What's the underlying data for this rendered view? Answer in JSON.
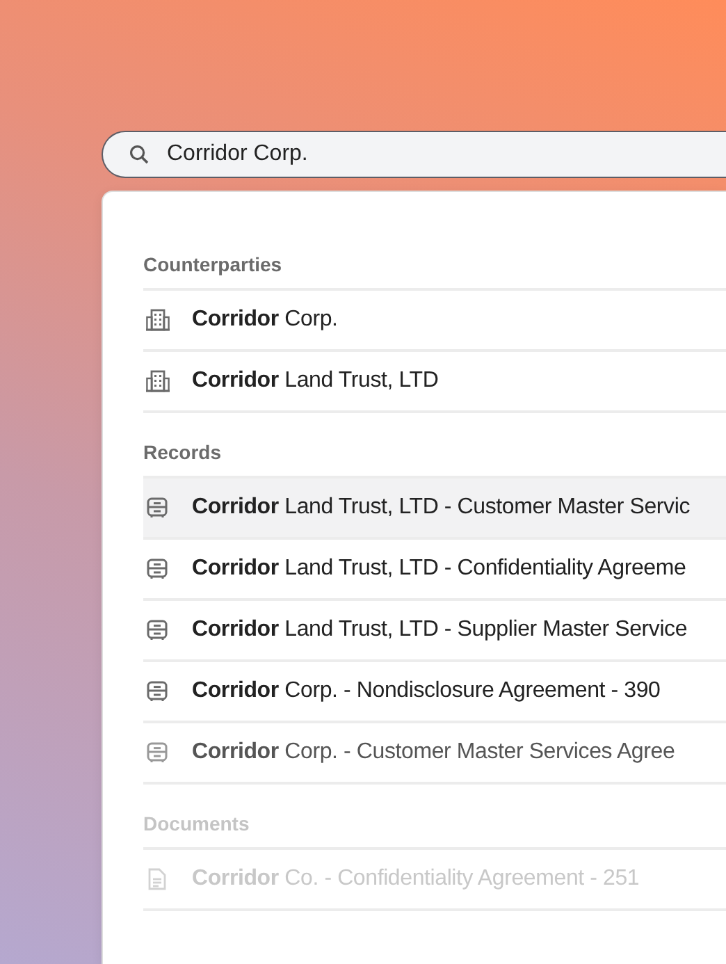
{
  "search": {
    "value": "Corridor Corp."
  },
  "sections": [
    {
      "heading": "Counterparties",
      "kind": "counterparty",
      "dimmed": false,
      "items": [
        {
          "label": "**Corridor** Corp.",
          "selected": false,
          "kind": "normal"
        },
        {
          "label": "**Corridor** Land Trust, LTD",
          "selected": false,
          "kind": "normal"
        }
      ]
    },
    {
      "heading": "Records",
      "kind": "record",
      "dimmed": false,
      "items": [
        {
          "label": "**Corridor** Land Trust, LTD - Customer Master Servic",
          "selected": true,
          "kind": "normal"
        },
        {
          "label": "**Corridor** Land Trust, LTD - Confidentiality Agreeme",
          "selected": false,
          "kind": "normal"
        },
        {
          "label": "**Corridor** Land Trust, LTD - Supplier Master Service",
          "selected": false,
          "kind": "normal"
        },
        {
          "label": "**Corridor** Corp. - Nondisclosure Agreement - 390",
          "selected": false,
          "kind": "normal"
        },
        {
          "label": "**Corridor** Corp. - Customer Master Services Agree",
          "selected": false,
          "kind": "muted"
        }
      ]
    },
    {
      "heading": "Documents",
      "kind": "document",
      "dimmed": true,
      "items": [
        {
          "label": "**Corridor** Co. - Confidentiality Agreement - 251",
          "selected": false,
          "kind": "faint"
        }
      ]
    }
  ]
}
